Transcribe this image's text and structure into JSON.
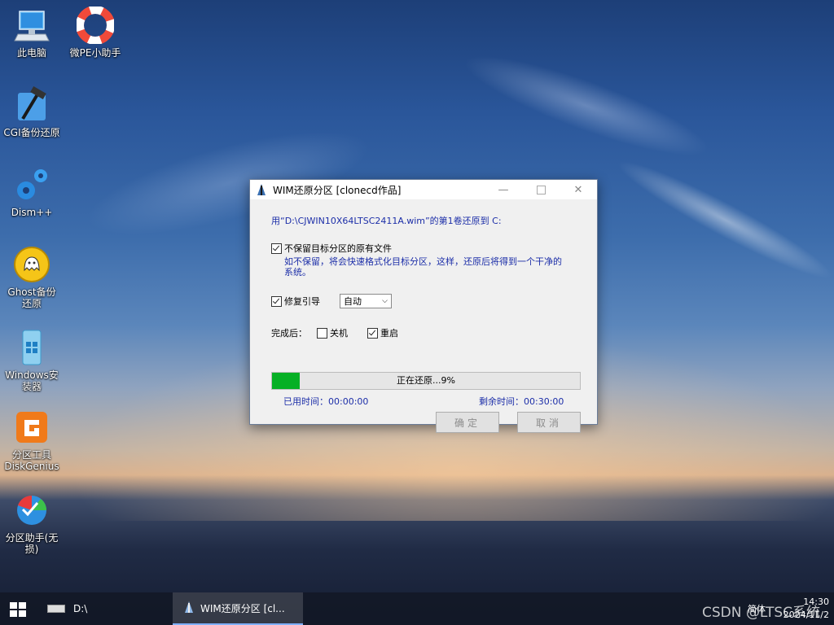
{
  "desktop": {
    "icons": [
      {
        "label": "此电脑",
        "icon": "computer-icon"
      },
      {
        "label": "微PE小助手",
        "icon": "lifebuoy-icon"
      },
      {
        "label": "CGI备份还原",
        "icon": "hammer-icon"
      },
      {
        "label": "Dism++",
        "icon": "gears-icon"
      },
      {
        "label": "Ghost备份还原",
        "icon": "ghost-icon"
      },
      {
        "label": "Windows安装器",
        "icon": "windows-installer-icon"
      },
      {
        "label": "分区工具DiskGenius",
        "icon": "diskgenius-icon"
      },
      {
        "label": "分区助手(无损)",
        "icon": "partition-assistant-icon"
      }
    ]
  },
  "dialog": {
    "title": "WIM还原分区  [clonecd作品]",
    "info_line": "用“D:\\CJWIN10X64LTSC2411A.wim”的第1卷还原到 C:",
    "no_keep_label": "不保留目标分区的原有文件",
    "no_keep_checked": true,
    "no_keep_desc_1": "如不保留，将会快速格式化目标分区，这样，还原后将得到一个干净的",
    "no_keep_desc_2": "系统。",
    "repair_boot_label": "修复引导",
    "repair_boot_checked": true,
    "repair_boot_option": "自动",
    "after_label": "完成后：",
    "shutdown_label": "关机",
    "shutdown_checked": false,
    "reboot_label": "重启",
    "reboot_checked": true,
    "progress_text": "正在还原...9%",
    "progress_percent": 9,
    "elapsed": "已用时间：00:00:00",
    "remaining": "剩余时间：00:30:00",
    "ok_label": "确定",
    "cancel_label": "取消"
  },
  "taskbar": {
    "drive_label": "D:\\",
    "task_label": "WIM还原分区  [cl...",
    "time": "14:30",
    "date": "2024/11/2",
    "tray_text": "简体"
  },
  "watermark": "CSDN @LTSC系统",
  "colors": {
    "progress_fill": "#06b025",
    "dialog_text_blue": "#1c2ea8"
  }
}
